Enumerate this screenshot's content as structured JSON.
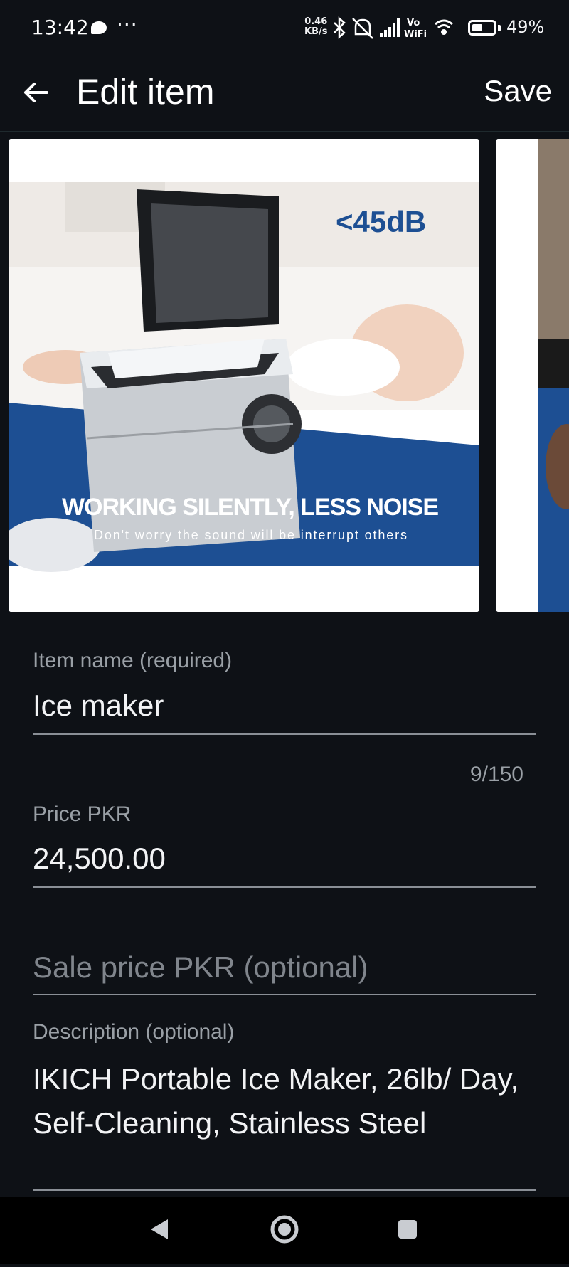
{
  "status_bar": {
    "time": "13:42",
    "net_speed_value": "0.46",
    "net_speed_unit": "KB/s",
    "vo_wifi_top": "Vo",
    "vo_wifi_bottom": "WiFi",
    "battery_percent": "49%",
    "battery_level": 0.49,
    "icons": [
      "chat-bubble-icon",
      "more-dots-icon",
      "bluetooth-icon",
      "mute-bell-icon",
      "signal-icon",
      "wifi-icon",
      "battery-icon"
    ]
  },
  "app_bar": {
    "title": "Edit item",
    "save_label": "Save",
    "back_icon": "arrow-left-icon"
  },
  "photos": {
    "main": {
      "badge": "<45dB",
      "caption": "WORKING SILENTLY, LESS NOISE",
      "subcaption": "Don't worry the sound will be interrupt others"
    }
  },
  "form": {
    "item_name": {
      "label": "Item name (required)",
      "value": "Ice maker",
      "counter": "9/150"
    },
    "price": {
      "label": "Price PKR",
      "value": "24,500.00"
    },
    "sale_price": {
      "placeholder": "Sale price PKR (optional)"
    },
    "description": {
      "label": "Description (optional)",
      "value": "IKICH Portable Ice Maker, 26lb/ Day, Self-Cleaning, Stainless Steel"
    }
  },
  "nav_bar": {
    "icons": [
      "back-triangle-icon",
      "home-circle-icon",
      "recents-square-icon"
    ]
  },
  "colors": {
    "background": "#0e1116",
    "text": "#f2f3f5",
    "muted": "#9aa0a6",
    "photo_blue": "#1d4f93"
  }
}
